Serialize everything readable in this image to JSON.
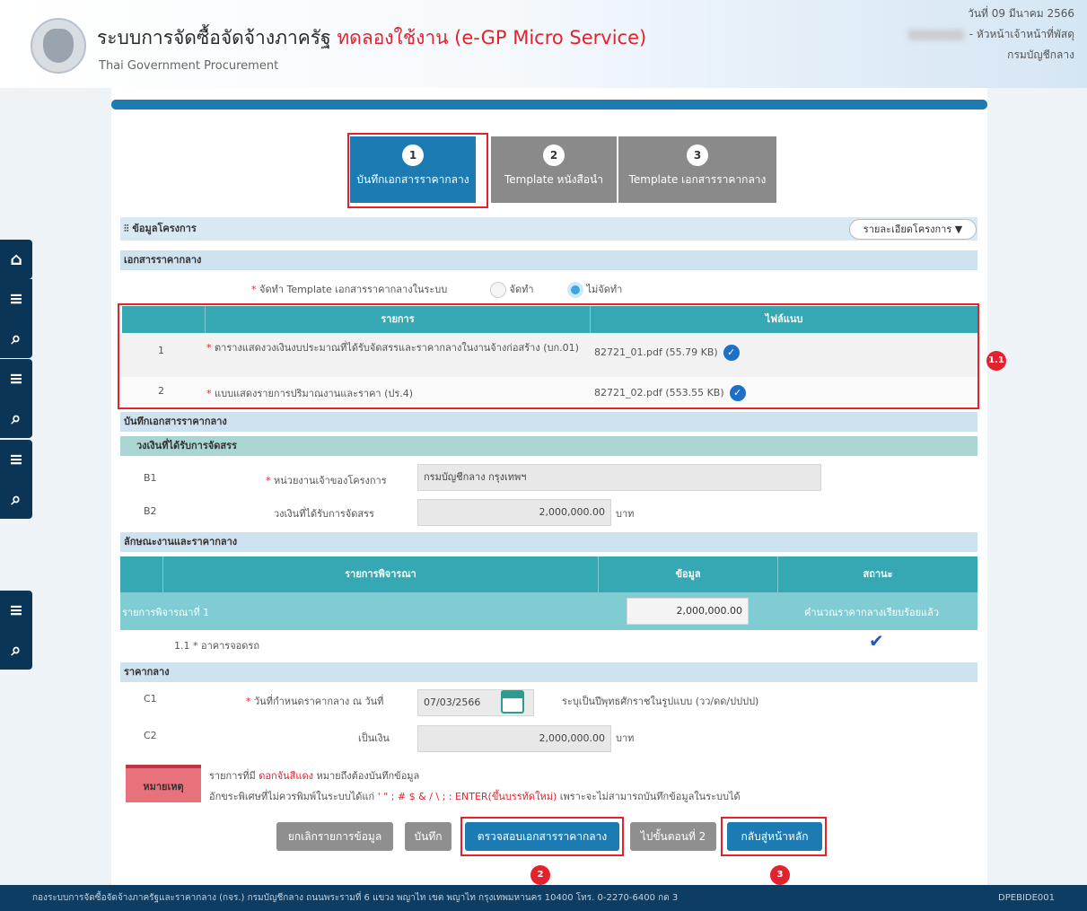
{
  "header": {
    "title_main": "ระบบการจัดซื้อจัดจ้างภาครัฐ",
    "title_test": "ทดลองใช้งาน (e-GP Micro Service)",
    "subtitle": "Thai Government Procurement",
    "date": "วันที่ 09 มีนาคม 2566",
    "role": "- หัวหน้าเจ้าหน้าที่พัสดุ",
    "department": "กรมบัญชีกลาง"
  },
  "sidebar": {
    "icons": [
      "home-icon",
      "menu-icon",
      "search-icon",
      "menu-icon",
      "search-icon",
      "menu-icon",
      "search-icon",
      "menu-icon",
      "search-icon"
    ]
  },
  "steps": [
    {
      "num": "1",
      "label": "บันทึกเอกสารราคากลาง"
    },
    {
      "num": "2",
      "label": "Template หนังสือนำ"
    },
    {
      "num": "3",
      "label": "Template เอกสารราคากลาง"
    }
  ],
  "project": {
    "section_title": "ข้อมูลโครงการ",
    "details_button": "รายละเอียดโครงการ"
  },
  "doc": {
    "section_title": "เอกสารราคากลาง",
    "template_label": "จัดทำ Template เอกสารราคากลางในระบบ",
    "opt_yes": "จัดทำ",
    "opt_no": "ไม่จัดทำ",
    "col_item": "รายการ",
    "col_file": "ไฟล์แนบ",
    "rows": [
      {
        "no": "1",
        "name": "ตารางแสดงวงเงินงบประมาณที่ได้รับจัดสรรและราคากลางในงานจ้างก่อสร้าง (บก.01)",
        "file": "82721_01.pdf (55.79 KB)"
      },
      {
        "no": "2",
        "name": "แบบแสดงรายการปริมาณงานและราคา (ปร.4)",
        "file": "82721_02.pdf (553.55 KB)"
      }
    ]
  },
  "record": {
    "section_title": "บันทึกเอกสารราคากลาง",
    "budget_sub": "วงเงินที่ได้รับการจัดสรร",
    "b1_code": "B1",
    "b1_label": "หน่วยงานเจ้าของโครงการ",
    "b1_value": "กรมบัญชีกลาง กรุงเทพฯ",
    "b2_code": "B2",
    "b2_label": "วงเงินที่ได้รับการจัดสรร",
    "b2_value": "2,000,000.00",
    "b2_unit": "บาท"
  },
  "character": {
    "section_title": "ลักษณะงานและราคากลาง",
    "col_item": "รายการพิจารณา",
    "col_data": "ข้อมูล",
    "col_status": "สถานะ",
    "row1_name": "รายการพิจารณาที่ 1",
    "row1_value": "2,000,000.00",
    "row1_status": "คำนวณราคากลางเรียบร้อยแล้ว",
    "row2_name": "1.1 * อาคารจอดรถ"
  },
  "price": {
    "section_title": "ราคากลาง",
    "c1_code": "C1",
    "c1_label": "วันที่กำหนดราคากลาง ณ วันที่",
    "c1_value": "07/03/2566",
    "c1_hint": "ระบุเป็นปีพุทธศักราชในรูปแบบ (วว/ดด/ปปปป)",
    "c2_code": "C2",
    "c2_label": "เป็นเงิน",
    "c2_value": "2,000,000.00",
    "c2_unit": "บาท"
  },
  "note": {
    "label": "หมายเหตุ",
    "line1_pre": "รายการที่มี",
    "line1_red": "ดอกจันสีแดง",
    "line1_post": "หมายถึงต้องบันทึกข้อมูล",
    "line2_pre": "อักขระพิเศษที่ไม่ควรพิมพ์ในระบบได้แก่",
    "line2_red": "' \" ; # $ & / \\ ; : ENTER(ขึ้นบรรทัดใหม่)",
    "line2_post": "เพราะจะไม่สามารถบันทึกข้อมูลในระบบได้"
  },
  "buttons": {
    "cancel": "ยกเลิกรายการข้อมูล",
    "save": "บันทึก",
    "verify": "ตรวจสอบเอกสารราคากลาง",
    "next": "ไปขั้นตอนที่ 2",
    "back": "กลับสู่หน้าหลัก"
  },
  "badges": {
    "b11": "1.1",
    "b2": "2",
    "b3": "3"
  },
  "footer": {
    "text": "กองระบบการจัดซื้อจัดจ้างภาครัฐและราคากลาง (กจร.) กรมบัญชีกลาง ถนนพระรามที่ 6 แขวง พญาไท เขต พญาไท กรุงเทพมหานคร 10400 โทร. 0-2270-6400 กด 3",
    "code": "DPEBIDE001"
  },
  "colors": {
    "brand": "#1b7bb2",
    "teal": "#35a8b3",
    "red": "#e4222e",
    "navy": "#0e3d63"
  }
}
